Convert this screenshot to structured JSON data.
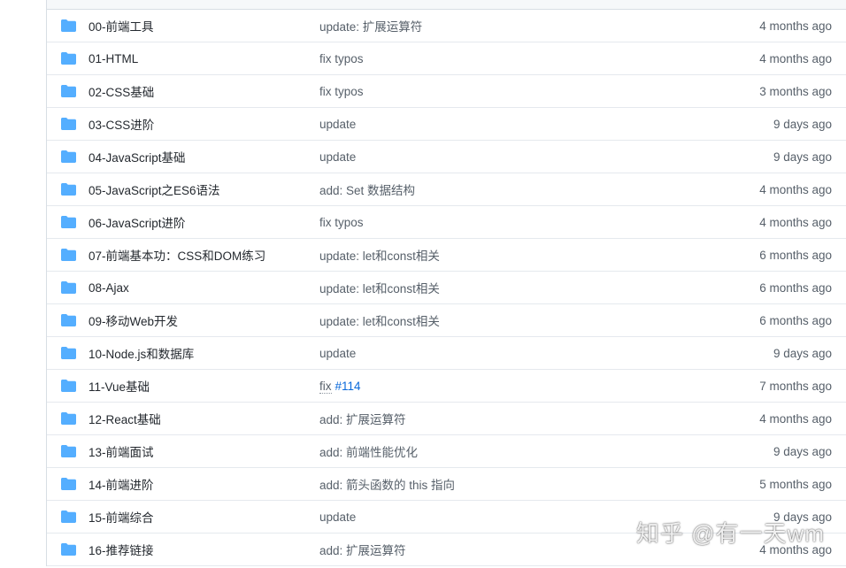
{
  "colors": {
    "folder": "#54aeff",
    "text": "#24292f",
    "muted": "#57606a",
    "link": "#0969da",
    "border": "#d8dee4"
  },
  "rows": [
    {
      "name": "00-前端工具",
      "commit": "update: 扩展运算符",
      "age": "4 months ago",
      "icon": "folder-icon"
    },
    {
      "name": "01-HTML",
      "commit": "fix typos",
      "age": "4 months ago",
      "icon": "folder-icon"
    },
    {
      "name": "02-CSS基础",
      "commit": "fix typos",
      "age": "3 months ago",
      "icon": "folder-icon"
    },
    {
      "name": "03-CSS进阶",
      "commit": "update",
      "age": "9 days ago",
      "icon": "folder-icon"
    },
    {
      "name": "04-JavaScript基础",
      "commit": "update",
      "age": "9 days ago",
      "icon": "folder-icon"
    },
    {
      "name": "05-JavaScript之ES6语法",
      "commit": "add: Set 数据结构",
      "age": "4 months ago",
      "icon": "folder-icon"
    },
    {
      "name": "06-JavaScript进阶",
      "commit": "fix typos",
      "age": "4 months ago",
      "icon": "folder-icon"
    },
    {
      "name": "07-前端基本功：CSS和DOM练习",
      "commit": "update: let和const相关",
      "age": "6 months ago",
      "icon": "folder-icon"
    },
    {
      "name": "08-Ajax",
      "commit": "update: let和const相关",
      "age": "6 months ago",
      "icon": "folder-icon"
    },
    {
      "name": "09-移动Web开发",
      "commit": "update: let和const相关",
      "age": "6 months ago",
      "icon": "folder-icon"
    },
    {
      "name": "10-Node.js和数据库",
      "commit": "update",
      "age": "9 days ago",
      "icon": "folder-icon"
    },
    {
      "name": "11-Vue基础",
      "commit": "fix",
      "commit_ref": "#114",
      "age": "7 months ago",
      "icon": "folder-icon"
    },
    {
      "name": "12-React基础",
      "commit": "add: 扩展运算符",
      "age": "4 months ago",
      "icon": "folder-icon"
    },
    {
      "name": "13-前端面试",
      "commit": "add: 前端性能优化",
      "age": "9 days ago",
      "icon": "folder-icon"
    },
    {
      "name": "14-前端进阶",
      "commit": "add: 箭头函数的 this 指向",
      "age": "5 months ago",
      "icon": "folder-icon"
    },
    {
      "name": "15-前端综合",
      "commit": "update",
      "age": "9 days ago",
      "icon": "folder-icon"
    },
    {
      "name": "16-推荐链接",
      "commit": "add: 扩展运算符",
      "age": "4 months ago",
      "icon": "folder-icon"
    }
  ],
  "watermark": "知乎 @有一天wm"
}
